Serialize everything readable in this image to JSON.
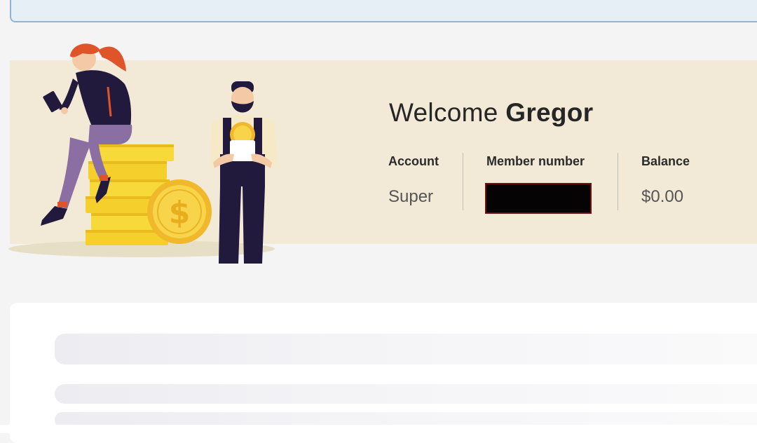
{
  "welcome": {
    "greeting": "Welcome",
    "name": "Gregor"
  },
  "account": {
    "label": "Account",
    "value": "Super"
  },
  "member": {
    "label": "Member number",
    "value_redacted": true
  },
  "balance": {
    "label": "Balance",
    "value": "$0.00"
  },
  "colors": {
    "hero_background": "#f2ead6",
    "coin_gold": "#f5cf2c",
    "figure_navy": "#221a3d",
    "hair_orange": "#e0542a"
  },
  "icons": [
    "woman-reading-illustration",
    "coin-stack-illustration",
    "dollar-coin-icon",
    "man-with-coin-illustration"
  ]
}
